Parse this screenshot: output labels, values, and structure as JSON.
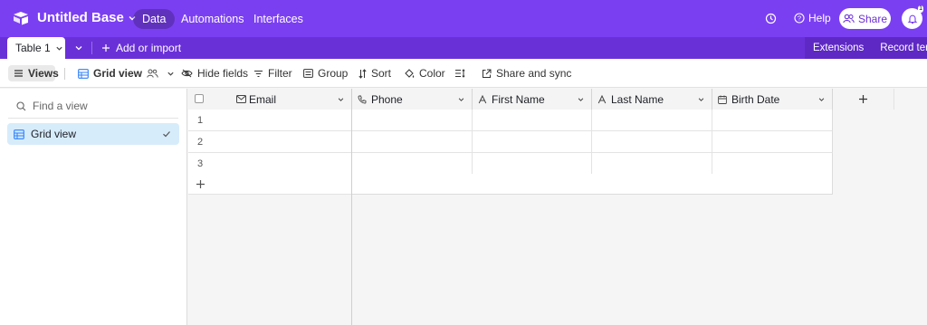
{
  "app": {
    "base_title": "Untitled Base",
    "nav_tabs": [
      {
        "label": "Data",
        "active": true
      },
      {
        "label": "Automations",
        "active": false
      },
      {
        "label": "Interfaces",
        "active": false
      }
    ],
    "help_label": "Help",
    "share_label": "Share",
    "notification_count": "1",
    "accent_color": "#7b3ff2"
  },
  "tabbar": {
    "table_tab_label": "Table 1",
    "add_import_label": "Add or import",
    "extensions_label": "Extensions",
    "record_templates_label": "Record templ"
  },
  "toolbar": {
    "views_label": "Views",
    "grid_view_label": "Grid view",
    "hide_fields_label": "Hide fields",
    "filter_label": "Filter",
    "group_label": "Group",
    "sort_label": "Sort",
    "color_label": "Color",
    "share_sync_label": "Share and sync"
  },
  "sidebar": {
    "find_placeholder": "Find a view",
    "views": [
      {
        "label": "Grid view",
        "selected": true
      }
    ]
  },
  "grid": {
    "columns": [
      {
        "label": "Email",
        "icon": "mail-icon"
      },
      {
        "label": "Phone",
        "icon": "phone-icon"
      },
      {
        "label": "First Name",
        "icon": "text-icon"
      },
      {
        "label": "Last Name",
        "icon": "text-icon"
      },
      {
        "label": "Birth Date",
        "icon": "calendar-icon"
      }
    ],
    "rows": [
      {
        "num": "1",
        "cells": [
          "",
          "",
          "",
          "",
          ""
        ]
      },
      {
        "num": "2",
        "cells": [
          "",
          "",
          "",
          "",
          ""
        ]
      },
      {
        "num": "3",
        "cells": [
          "",
          "",
          "",
          "",
          ""
        ]
      }
    ]
  }
}
